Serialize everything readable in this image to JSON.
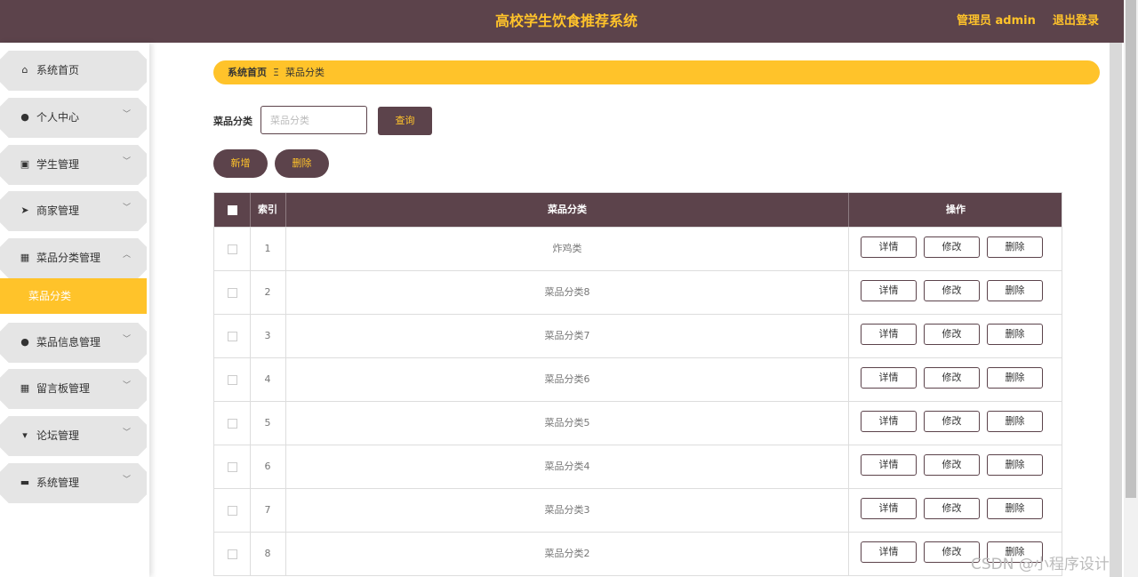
{
  "header": {
    "title": "高校学生饮食推荐系统",
    "admin": "管理员 admin",
    "logout": "退出登录"
  },
  "sidebar": {
    "items": [
      {
        "label": "系统首页",
        "icon": "home-icon",
        "expandable": false
      },
      {
        "label": "个人中心",
        "icon": "user-icon",
        "expandable": true
      },
      {
        "label": "学生管理",
        "icon": "clipboard-icon",
        "expandable": true
      },
      {
        "label": "商家管理",
        "icon": "send-icon",
        "expandable": true
      },
      {
        "label": "菜品分类管理",
        "icon": "grid-icon",
        "expandable": true,
        "expanded": true
      },
      {
        "label": "菜品信息管理",
        "icon": "bulb-icon",
        "expandable": true
      },
      {
        "label": "留言板管理",
        "icon": "grid-icon",
        "expandable": true
      },
      {
        "label": "论坛管理",
        "icon": "sign-icon",
        "expandable": true
      },
      {
        "label": "系统管理",
        "icon": "monitor-icon",
        "expandable": true
      }
    ],
    "submenu_active": "菜品分类"
  },
  "breadcrumb": {
    "home": "系统首页",
    "sep": "Ξ",
    "current": "菜品分类"
  },
  "search": {
    "label": "菜品分类",
    "placeholder": "菜品分类",
    "value": "",
    "button": "查询"
  },
  "actions": {
    "add": "新增",
    "delete": "删除"
  },
  "table": {
    "headers": {
      "index": "索引",
      "category": "菜品分类",
      "ops": "操作"
    },
    "op_labels": {
      "detail": "详情",
      "edit": "修改",
      "delete": "删除"
    },
    "rows": [
      {
        "index": "1",
        "category": "炸鸡类"
      },
      {
        "index": "2",
        "category": "菜品分类8"
      },
      {
        "index": "3",
        "category": "菜品分类7"
      },
      {
        "index": "4",
        "category": "菜品分类6"
      },
      {
        "index": "5",
        "category": "菜品分类5"
      },
      {
        "index": "6",
        "category": "菜品分类4"
      },
      {
        "index": "7",
        "category": "菜品分类3"
      },
      {
        "index": "8",
        "category": "菜品分类2"
      }
    ]
  },
  "watermark": "CSDN @小程序设计",
  "colors": {
    "primary": "#5c434b",
    "accent": "#ffc32a"
  }
}
